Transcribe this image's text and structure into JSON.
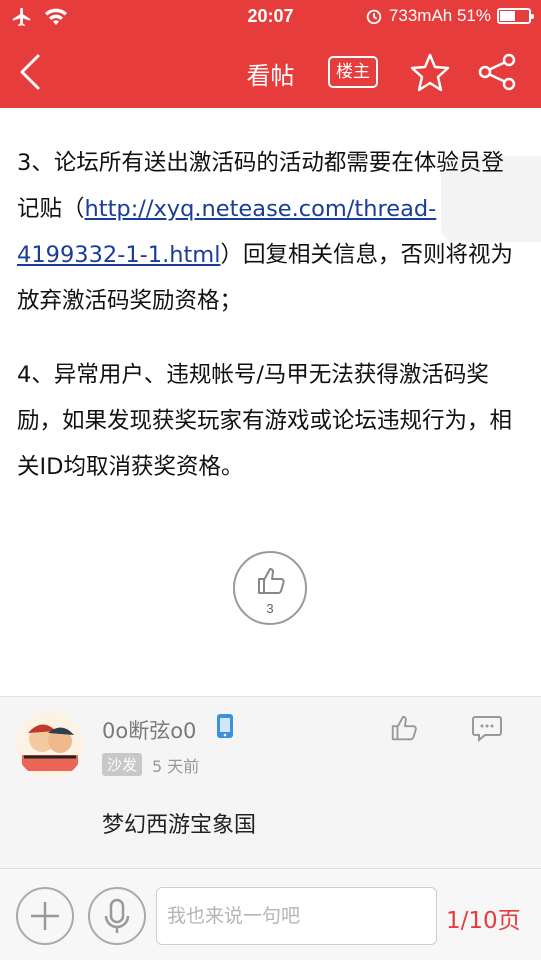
{
  "status_bar": {
    "time": "20:07",
    "battery_text": "733mAh 51%",
    "battery_level": 0.51
  },
  "nav": {
    "title": "看帖",
    "owner_label": "楼主"
  },
  "post": {
    "para1_prefix": " 3、论坛所有送出激活码的活动都需要在体验员登记贴（",
    "para1_link": "http://xyq.netease.com/thread-4199332-1-1.html",
    "para1_suffix": "）回复相关信息，否则将视为放弃激活码奖励资格；",
    "para2": " 4、异常用户、违规帐号/马甲无法获得激活码奖励，如果发现获奖玩家有游戏或论坛违规行为，相关ID均取消获奖资格。",
    "like_count": "3"
  },
  "comment": {
    "username": "0o断弦o0",
    "floor": "沙发",
    "time_ago": "5 天前",
    "text": "梦幻西游宝象国"
  },
  "bottom": {
    "input_placeholder": "我也来说一句吧",
    "page": "1/10页"
  },
  "colors": {
    "accent": "#e63c3c",
    "link": "#1a3c9a"
  }
}
